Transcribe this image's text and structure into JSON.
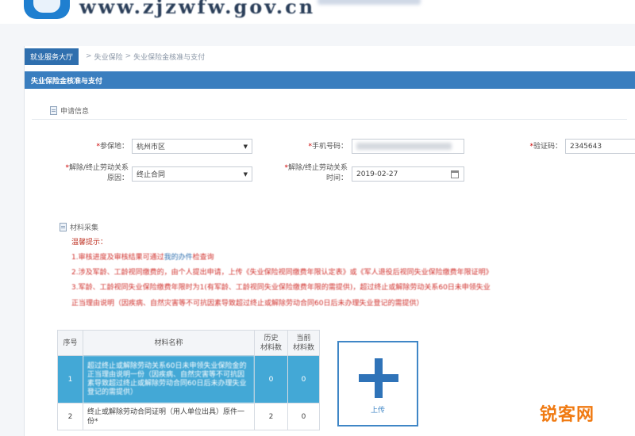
{
  "header": {
    "site_url": "www.zjzwfw.gov.cn"
  },
  "breadcrumb": {
    "home": "就业服务大厅",
    "sep": ">",
    "level1": "失业保险",
    "level2": "失业保险金核准与支付"
  },
  "panel": {
    "title": "失业保险金核准与支付"
  },
  "application": {
    "section_title": "申请信息",
    "insured_place_label": "参保地：",
    "insured_place_value": "杭州市区",
    "phone_label": "手机号码：",
    "verify_code_label": "验证码：",
    "verify_code_value": "2345643",
    "termination_reason_label_1": "解除/终止劳动关系",
    "termination_reason_label_2": "原因：",
    "termination_reason_value": "终止合同",
    "termination_date_label_1": "解除/终止劳动关系",
    "termination_date_label_2": "时间：",
    "termination_date_value": "2019-02-27"
  },
  "materials": {
    "section_title": "材料采集",
    "notice_title": "温馨提示：",
    "notice_line1_prefix": "1.审核进度及审核结果可通过",
    "notice_line1_link": "我的办件",
    "notice_line1_suffix": "检查询",
    "notice_line2": "2.涉及军龄、工龄视同缴费的，由个人提出申请，上传《失业保险视同缴费年限认定表》或《军人退役后视同失业保险缴费年限证明》",
    "notice_line3": "3.军龄、工龄视同失业保险缴费年限时为1(有军龄、工龄视同失业保险缴费年限的需提供)，超过终止或解除劳动关系60日未申领失业",
    "notice_line4": "正当理由说明（因疾病、自然灾害等不可抗因素导致超过终止或解除劳动合同60日后未办理失业登记的需提供）",
    "table": {
      "col_no": "序号",
      "col_name": "材料名称",
      "col_history_1": "历史",
      "col_history_2": "材料数",
      "col_current_1": "当前",
      "col_current_2": "材料数",
      "rows": [
        {
          "no": "1",
          "name": "超过终止或解除劳动关系60日未申领失业保险金的正当理由说明一份（因疾病、自然灾害等不可抗因素导致超过终止或解除劳动合同60日后未办理失业登记的需提供）",
          "history": "0",
          "current": "0"
        },
        {
          "no": "2",
          "name": "终止或解除劳动合同证明（用人单位出具）原件一份*",
          "history": "2",
          "current": "0"
        }
      ]
    },
    "upload_label": "上传"
  },
  "watermark": "锐客网"
}
